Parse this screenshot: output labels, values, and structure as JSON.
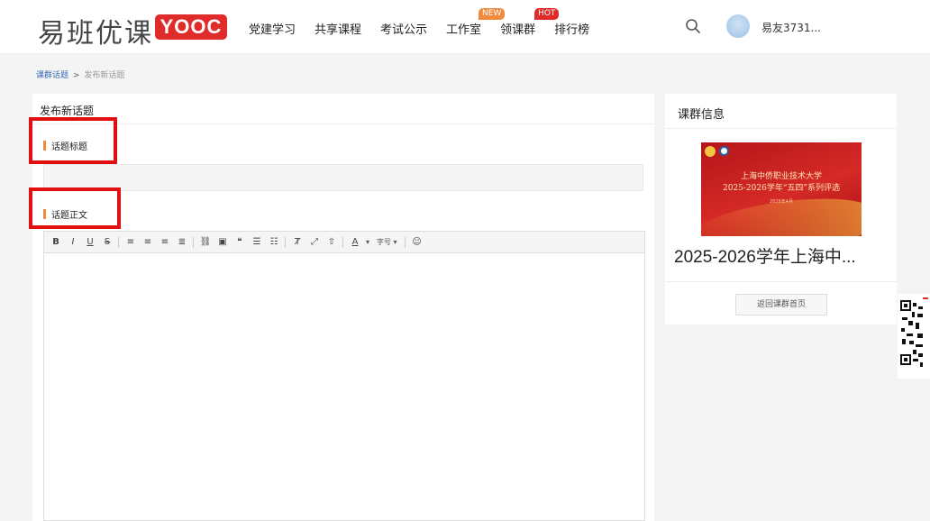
{
  "header": {
    "logo_text": "易班优课",
    "logo_badge": "YOOC",
    "nav": [
      {
        "label": "党建学习",
        "tag": ""
      },
      {
        "label": "共享课程",
        "tag": ""
      },
      {
        "label": "考试公示",
        "tag": ""
      },
      {
        "label": "工作室",
        "tag": "NEW"
      },
      {
        "label": "领课群",
        "tag": "HOT"
      },
      {
        "label": "排行榜",
        "tag": ""
      }
    ],
    "username": "易友3731..."
  },
  "breadcrumb": {
    "link": "课群话题",
    "separator": ">",
    "current": "发布新话题"
  },
  "main": {
    "title": "发布新话题",
    "topic_title_label": "话题标题",
    "topic_body_label": "话题正文",
    "toolbar": {
      "bold": "B",
      "italic": "I",
      "underline": "U",
      "strike": "S",
      "font_color": "A",
      "font_size": "字号"
    }
  },
  "side": {
    "title": "课群信息",
    "banner_line1": "上海中侨职业技术大学",
    "banner_line2": "2025-2026学年“五四”系列评选",
    "banner_line3": "2026年4月",
    "group_name": "2025-2026学年上海中...",
    "back_button": "返回课群首页"
  },
  "colors": {
    "accent_orange": "#f08a3c",
    "brand_red": "#e02b2b",
    "highlight_red": "#e01010",
    "link_blue": "#3b6bb4"
  }
}
